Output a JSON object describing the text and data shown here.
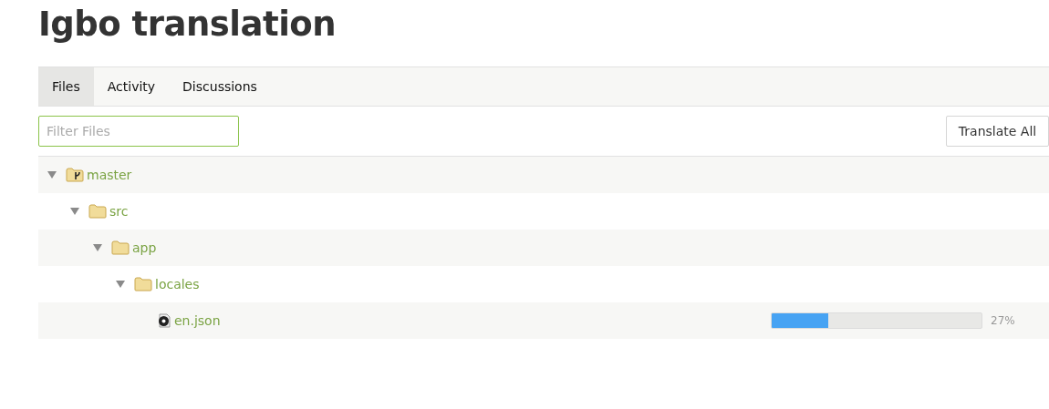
{
  "title": "Igbo translation",
  "tabs": [
    {
      "label": "Files",
      "selected": true
    },
    {
      "label": "Activity",
      "selected": false
    },
    {
      "label": "Discussions",
      "selected": false
    }
  ],
  "filter": {
    "placeholder": "Filter Files"
  },
  "translate_button": "Translate All",
  "tree": [
    {
      "kind": "repo",
      "name": "master",
      "expanded": true,
      "children": [
        {
          "kind": "folder",
          "name": "src",
          "expanded": true,
          "children": [
            {
              "kind": "folder",
              "name": "app",
              "expanded": true,
              "children": [
                {
                  "kind": "folder",
                  "name": "locales",
                  "expanded": true,
                  "children": [
                    {
                      "kind": "file",
                      "name": "en.json",
                      "level": 0.27,
                      "reading": "27%"
                    }
                  ]
                }
              ]
            }
          ]
        }
      ]
    }
  ]
}
